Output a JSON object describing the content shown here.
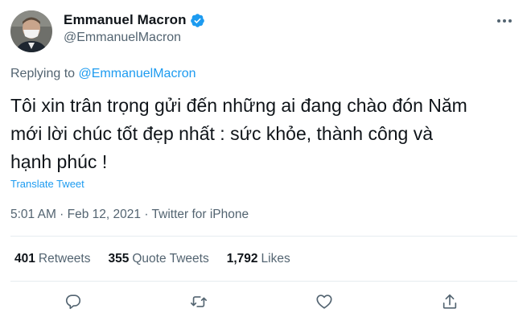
{
  "author": {
    "display_name": "Emmanuel Macron",
    "handle": "@EmmanuelMacron",
    "verified": true
  },
  "reply": {
    "prefix": "Replying to ",
    "mention": "@EmmanuelMacron"
  },
  "tweet": {
    "text": "Tôi xin trân trọng gửi đến những ai đang chào đón Năm\nmới lời chúc tốt đẹp nhất : sức khỏe, thành công và\nhạnh phúc !",
    "translate_label": "Translate Tweet"
  },
  "meta": {
    "time": "5:01 AM",
    "separator": " · ",
    "date": "Feb 12, 2021",
    "source": "Twitter for iPhone"
  },
  "stats": {
    "retweets": {
      "count": "401",
      "label": "Retweets"
    },
    "quotes": {
      "count": "355",
      "label": "Quote Tweets"
    },
    "likes": {
      "count": "1,792",
      "label": "Likes"
    }
  },
  "icons": {
    "more": "more-horizontal-icon",
    "verified": "verified-badge-icon",
    "reply": "reply-icon",
    "retweet": "retweet-icon",
    "like": "heart-icon",
    "share": "share-icon"
  },
  "colors": {
    "accent": "#1d9bf0",
    "text": "#0f1419",
    "secondary": "#536471",
    "divider": "#e6ecf0"
  }
}
